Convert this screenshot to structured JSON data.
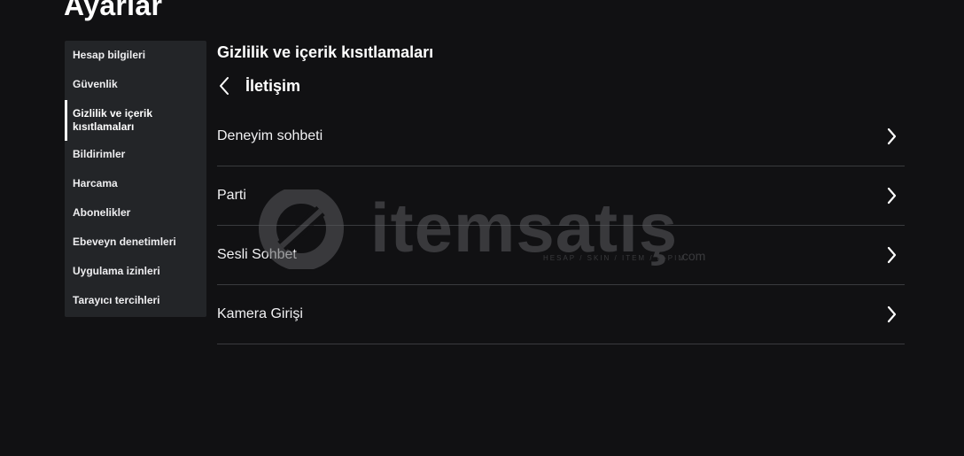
{
  "page": {
    "title": "Ayarlar"
  },
  "sidebar": {
    "items": [
      {
        "label": "Hesap bilgileri",
        "active": false
      },
      {
        "label": "Güvenlik",
        "active": false
      },
      {
        "label": "Gizlilik ve içerik kısıtlamaları",
        "active": true
      },
      {
        "label": "Bildirimler",
        "active": false
      },
      {
        "label": "Harcama",
        "active": false
      },
      {
        "label": "Abonelikler",
        "active": false
      },
      {
        "label": "Ebeveyn denetimleri",
        "active": false
      },
      {
        "label": "Uygulama izinleri",
        "active": false
      },
      {
        "label": "Tarayıcı tercihleri",
        "active": false
      }
    ]
  },
  "content": {
    "section_title": "Gizlilik ve içerik kısıtlamaları",
    "back_icon": "chevron-left-icon",
    "subpage_title": "İletişim",
    "items": [
      {
        "label": "Deneyim sohbeti",
        "icon": "chevron-right-icon"
      },
      {
        "label": "Parti",
        "icon": "chevron-right-icon"
      },
      {
        "label": "Sesli Sohbet",
        "icon": "chevron-right-icon"
      },
      {
        "label": "Kamera Girişi",
        "icon": "chevron-right-icon"
      }
    ]
  },
  "watermark": {
    "brand": "itemsatış",
    "tagline": "HESAP / SKIN / ITEM / E-PIN",
    "suffix": ".com"
  },
  "colors": {
    "background": "#111113",
    "sidebar": "#232528",
    "text": "#f7f7f8",
    "divider": "#3a3b3e"
  }
}
